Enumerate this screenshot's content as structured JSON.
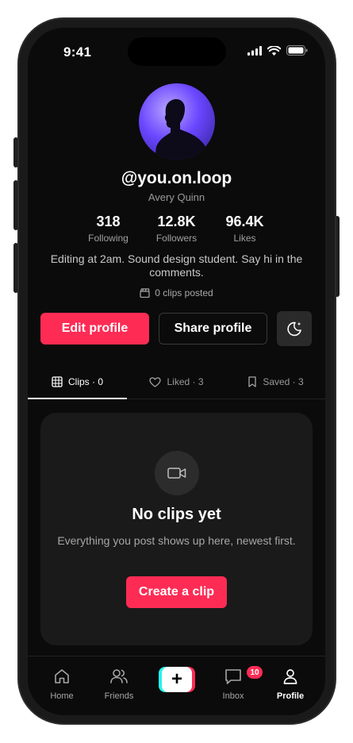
{
  "status_bar": {
    "time": "9:41"
  },
  "profile": {
    "username": "@you.on.loop",
    "display_name": "Avery Quinn",
    "stats": [
      {
        "value": "318",
        "label": "Following"
      },
      {
        "value": "12.8K",
        "label": "Followers"
      },
      {
        "value": "96.4K",
        "label": "Likes"
      }
    ],
    "bio": "Editing at 2am. Sound design student. Say hi in the comments.",
    "clips_posted": "0 clips posted"
  },
  "actions": {
    "edit_label": "Edit profile",
    "share_label": "Share profile",
    "theme_icon": "moon-sparkle-icon"
  },
  "tabs": [
    {
      "label": "Clips · 0",
      "icon": "grid-icon",
      "active": true
    },
    {
      "label": "Liked · 3",
      "icon": "heart-icon",
      "active": false
    },
    {
      "label": "Saved · 3",
      "icon": "bookmark-icon",
      "active": false
    }
  ],
  "empty_state": {
    "icon": "video-camera-icon",
    "title": "No clips yet",
    "subtitle": "Everything you post shows up here, newest first.",
    "button_label": "Create a clip"
  },
  "bottom_nav": {
    "items": [
      {
        "label": "Home",
        "icon": "home-icon"
      },
      {
        "label": "Friends",
        "icon": "friends-icon"
      },
      {
        "label": "",
        "icon": "plus-icon"
      },
      {
        "label": "Inbox",
        "icon": "inbox-icon",
        "badge": "10"
      },
      {
        "label": "Profile",
        "icon": "profile-icon",
        "active": true
      }
    ]
  },
  "colors": {
    "accent": "#fe2c55",
    "accent_secondary": "#25f4ee",
    "background": "#0b0b0b"
  }
}
